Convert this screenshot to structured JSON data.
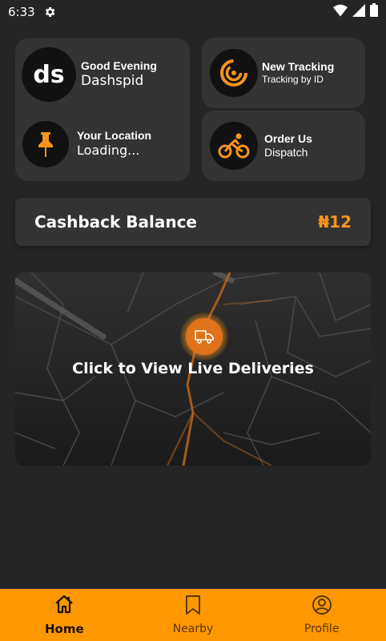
{
  "status_bar": {
    "time": "6:33",
    "icons": [
      "gear-icon",
      "wifi-icon",
      "signal-icon",
      "battery-icon"
    ]
  },
  "greeting": {
    "logo_text": "ds",
    "title": "Good Evening",
    "name": "Dashspid"
  },
  "location": {
    "title": "Your Location",
    "value": "Loading..."
  },
  "tracking": {
    "title": "New Tracking",
    "subtitle": "Tracking by ID"
  },
  "order": {
    "title": "Order Us",
    "subtitle": "Dispatch"
  },
  "cashback": {
    "label": "Cashback Balance",
    "value": "₦12"
  },
  "map": {
    "label": "Click to View Live Deliveries"
  },
  "nav": {
    "items": [
      {
        "label": "Home",
        "icon": "home-icon",
        "active": true
      },
      {
        "label": "Nearby",
        "icon": "bookmark-icon",
        "active": false
      },
      {
        "label": "Profile",
        "icon": "profile-icon",
        "active": false
      }
    ]
  },
  "colors": {
    "accent": "#f7941d",
    "nav_bg": "#ff9800",
    "card_bg": "#333333",
    "page_bg": "#252525"
  }
}
